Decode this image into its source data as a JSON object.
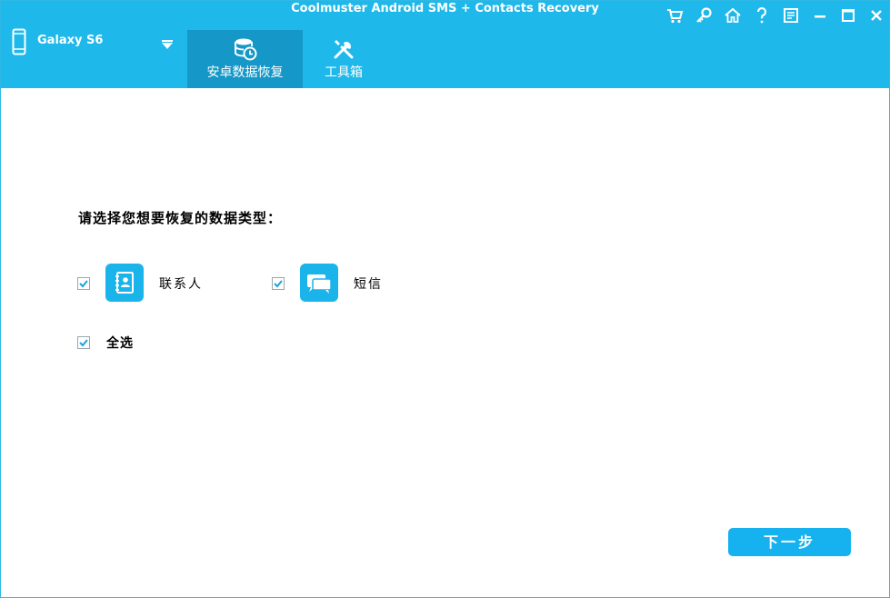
{
  "window": {
    "title": "Coolmuster Android SMS + Contacts Recovery"
  },
  "device": {
    "name": "Galaxy S6",
    "icon": "phone-icon",
    "dropdown_icon": "triangle-down-icon"
  },
  "tabs": [
    {
      "label": "安卓数据恢复",
      "icon": "database-clock-icon",
      "active": true
    },
    {
      "label": "工具箱",
      "icon": "tools-icon",
      "active": false
    }
  ],
  "toolbar_icons": [
    "cart-icon",
    "key-icon",
    "home-icon",
    "help-icon",
    "feedback-icon",
    "minimize-icon",
    "maximize-icon",
    "close-icon"
  ],
  "main": {
    "heading": "请选择您想要恢复的数据类型：",
    "types": [
      {
        "label": "联系人",
        "checked": true,
        "icon": "contacts-book-icon"
      },
      {
        "label": "短信",
        "checked": true,
        "icon": "message-bubbles-icon"
      }
    ],
    "select_all": {
      "label": "全选",
      "checked": true
    },
    "next_button": "下一步"
  },
  "colors": {
    "accent": "#1eb8ea",
    "tab_active": "#1598c7",
    "button": "#15b2ef"
  }
}
